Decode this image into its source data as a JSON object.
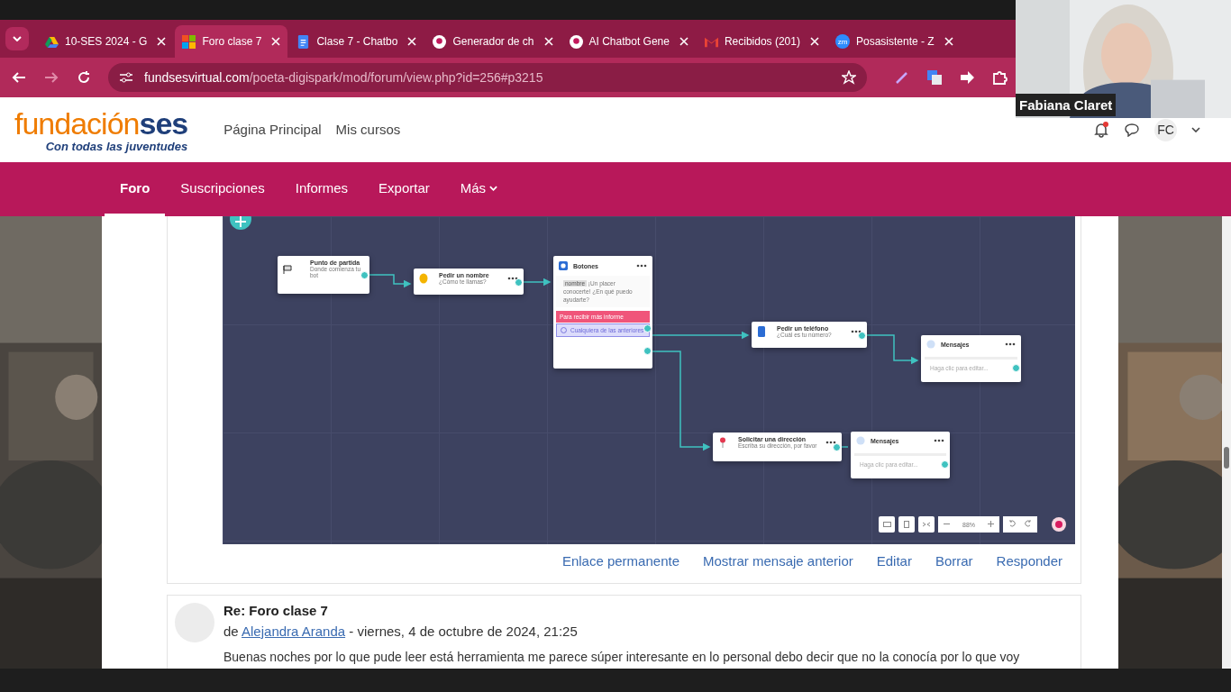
{
  "browser": {
    "tabs": [
      {
        "title": "10-SES 2024 - G",
        "kind": "triangle",
        "selected": false
      },
      {
        "title": "Foro clase 7",
        "kind": "squares",
        "selected": true
      },
      {
        "title": "Clase 7 - Chatbo",
        "kind": "document",
        "selected": false
      },
      {
        "title": "Generador de ch",
        "kind": "bubble",
        "selected": false
      },
      {
        "title": "AI Chatbot Gene",
        "kind": "bubble",
        "selected": false
      },
      {
        "title": "Recibidos (201)",
        "kind": "envelope",
        "selected": false
      },
      {
        "title": "Posasistente - Z",
        "kind": "badge",
        "badge": "zm",
        "selected": false
      }
    ],
    "address": {
      "host": "fundsesvirtual.com",
      "path": "/poeta-digispark/mod/forum/view.php?id=256#p3215"
    }
  },
  "site": {
    "logo": {
      "name": "fundación",
      "accent": "ses",
      "tagline": "Con todas las juventudes"
    },
    "links": [
      "Página Principal",
      "Mis cursos"
    ],
    "user_initials": "FC"
  },
  "course_nav": [
    {
      "label": "Foro",
      "kind": "link",
      "selected": true
    },
    {
      "label": "Suscripciones",
      "kind": "link",
      "selected": false
    },
    {
      "label": "Informes",
      "kind": "link",
      "selected": false
    },
    {
      "label": "Exportar",
      "kind": "link",
      "selected": false
    },
    {
      "label": "Más",
      "kind": "menu",
      "selected": false
    }
  ],
  "flow": {
    "nodes": [
      {
        "kind": "start",
        "title": "Punto de partida",
        "subtitle": "Donde comienza tu bot"
      },
      {
        "kind": "question",
        "title": "Pedir un nombre",
        "subtitle": "¿Cómo te llamas?"
      },
      {
        "kind": "buttons",
        "title": "Botones",
        "variable": "nombre",
        "text": "¡Un placer conocerte! ¿En qué puedo ayudarte?",
        "options": [
          {
            "label": "Para recibir más informe",
            "kind": "primary"
          },
          {
            "label": "Cualquiera de las anteriores",
            "kind": "fallback"
          }
        ]
      },
      {
        "kind": "question",
        "title": "Pedir un teléfono",
        "subtitle": "¿Cuál es tu número?"
      },
      {
        "kind": "message",
        "title": "Mensajes",
        "placeholder": "Haga clic para editar..."
      },
      {
        "kind": "question",
        "title": "Solicitar una dirección",
        "subtitle": "Escriba su dirección, por favor"
      },
      {
        "kind": "message",
        "title": "Mensajes",
        "placeholder": "Haga clic para editar..."
      }
    ],
    "zoom": "88%"
  },
  "post_actions": [
    "Enlace permanente",
    "Mostrar mensaje anterior",
    "Editar",
    "Borrar",
    "Responder"
  ],
  "reply": {
    "title": "Re: Foro clase 7",
    "prefix": "de",
    "author": "Alejandra Aranda",
    "date": "- viernes, 4 de octubre de 2024, 21:25",
    "body": "Buenas noches por lo que pude leer está herramienta me parece súper interesante en lo personal debo decir que no la conocía por lo que voy"
  },
  "video": {
    "name": "Fabiana Claret"
  }
}
